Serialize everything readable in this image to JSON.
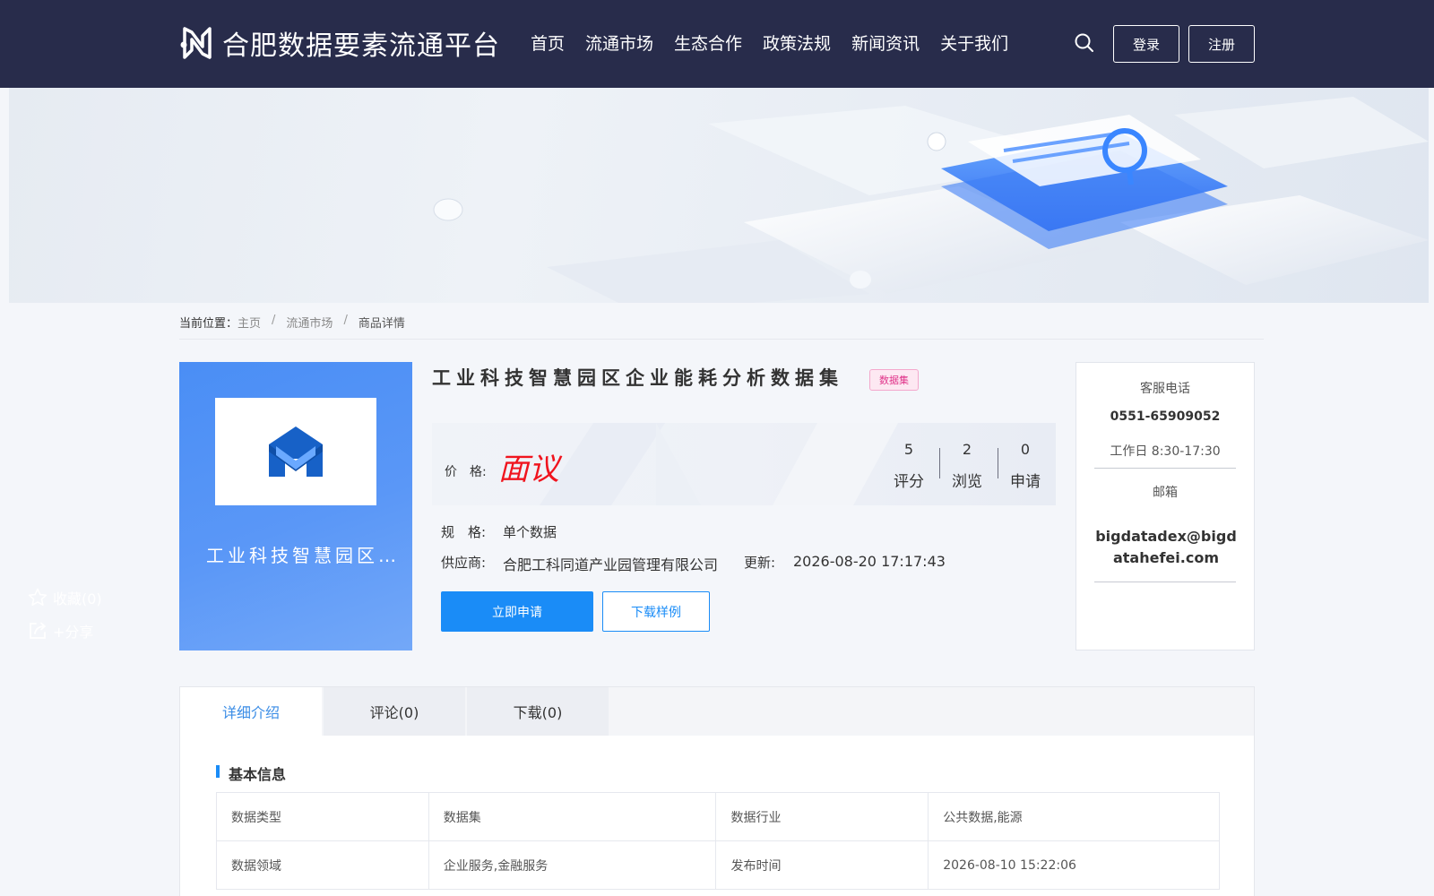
{
  "header": {
    "logo_text": "合肥数据要素流通平台",
    "nav": [
      "首页",
      "流通市场",
      "生态合作",
      "政策法规",
      "新闻资讯",
      "关于我们"
    ],
    "login_label": "登录",
    "register_label": "注册"
  },
  "breadcrumb": {
    "prefix": "当前位置：",
    "items": [
      "主页",
      "流通市场"
    ],
    "separator": "/",
    "current": "商品详情"
  },
  "product": {
    "card_name": "工业科技智慧园区企业能耗分析数据集",
    "favorite_label": "收藏(0)",
    "share_label": "+分享",
    "title": "工业科技智慧园区企业能耗分析数据集",
    "type_badge": "数据集",
    "price_label": "价　格:",
    "price_value": "面议",
    "stats": [
      {
        "value": "5",
        "label": "评分"
      },
      {
        "value": "2",
        "label": "浏览"
      },
      {
        "value": "0",
        "label": "申请"
      }
    ],
    "spec_label": "规　格:",
    "spec_value": "单个数据",
    "supplier_label": "供应商:",
    "supplier_value": "合肥工科同道产业园管理有限公司",
    "updated_label": "更新:",
    "updated_value": "2026-08-20 17:17:43",
    "apply_label": "立即申请",
    "download_label": "下载样例"
  },
  "contact": {
    "phone_label": "客服电话",
    "phone": "0551-65909052",
    "hours": "工作日 8:30-17:30",
    "email_label": "邮箱",
    "email": "bigdatadex@bigdatahefei.com"
  },
  "tabs": [
    "详细介绍",
    "评论(0)",
    "下载(0)"
  ],
  "basic_info": {
    "title": "基本信息",
    "rows": [
      [
        "数据类型",
        "数据集",
        "数据行业",
        "公共数据,能源"
      ],
      [
        "数据领域",
        "企业服务,金融服务",
        "发布时间",
        "2026-08-10 15:22:06"
      ]
    ]
  },
  "colors": {
    "header_bg": "#282c4b",
    "accent": "#1a8cf7",
    "price": "#f0141e",
    "badge": "#e0348a"
  },
  "icons": [
    "logo-icon",
    "search-icon",
    "star-icon",
    "share-icon",
    "product-logo-icon"
  ]
}
